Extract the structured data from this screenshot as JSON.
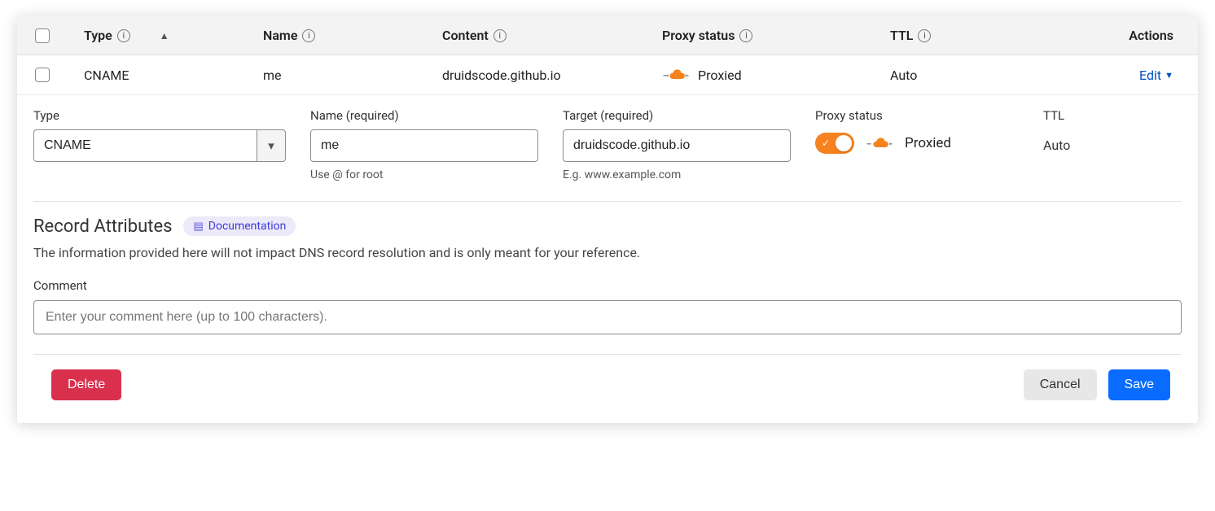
{
  "headers": {
    "type": "Type",
    "name": "Name",
    "content": "Content",
    "proxy": "Proxy status",
    "ttl": "TTL",
    "actions": "Actions"
  },
  "row": {
    "type": "CNAME",
    "name": "me",
    "content": "druidscode.github.io",
    "proxy": "Proxied",
    "ttl": "Auto",
    "edit": "Edit"
  },
  "form": {
    "type_label": "Type",
    "type_value": "CNAME",
    "name_label": "Name (required)",
    "name_value": "me",
    "name_hint": "Use @ for root",
    "target_label": "Target (required)",
    "target_value": "druidscode.github.io",
    "target_hint": "E.g. www.example.com",
    "proxy_label": "Proxy status",
    "proxy_state": "Proxied",
    "ttl_label": "TTL",
    "ttl_value": "Auto"
  },
  "attributes": {
    "title": "Record Attributes",
    "doc_link": "Documentation",
    "description": "The information provided here will not impact DNS record resolution and is only meant for your reference.",
    "comment_label": "Comment",
    "comment_placeholder": "Enter your comment here (up to 100 characters)."
  },
  "buttons": {
    "delete": "Delete",
    "cancel": "Cancel",
    "save": "Save"
  },
  "colors": {
    "orange": "#f6821f",
    "blue_link": "#0051c3",
    "primary": "#0a6cff",
    "danger": "#d9304e",
    "doc_bg": "#eceaf9",
    "doc_fg": "#403bdb"
  }
}
